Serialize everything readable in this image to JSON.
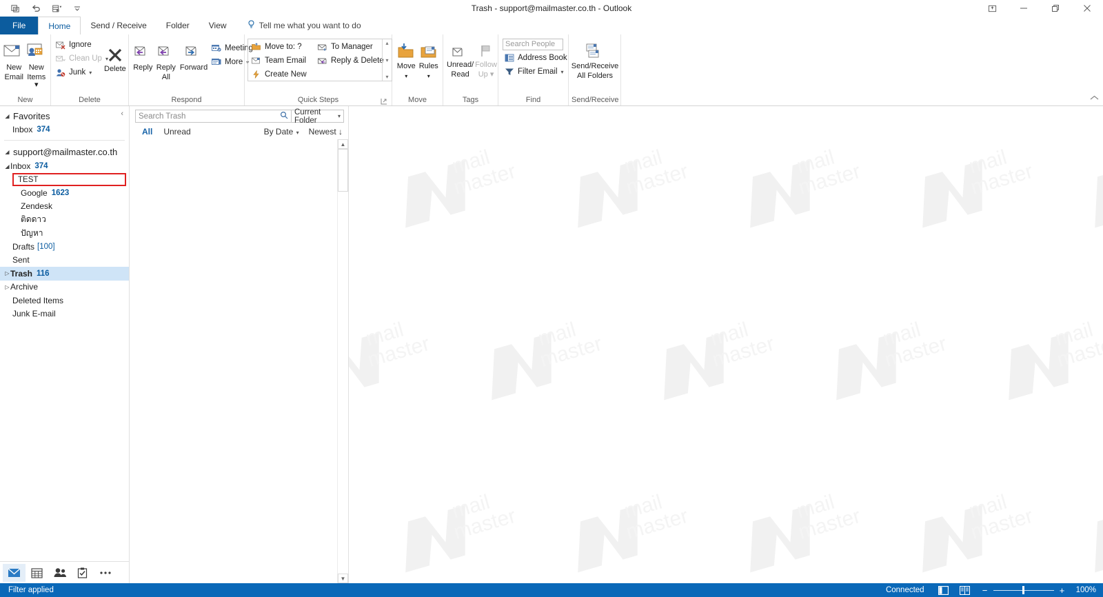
{
  "window": {
    "title": "Trash - support@mailmaster.co.th  -  Outlook",
    "quick_access": [
      {
        "name": "save-attachments-icon",
        "label": "Save"
      },
      {
        "name": "undo-icon",
        "label": "Undo"
      },
      {
        "name": "send-receive-icon",
        "label": "Send/Receive All Folders"
      },
      {
        "name": "customize-qat-icon",
        "label": "Customize Quick Access Toolbar"
      }
    ],
    "controls": {
      "ribbon_display": "Ribbon Display Options",
      "minimize": "Minimize",
      "restore": "Restore Down",
      "close": "Close"
    }
  },
  "tabs": [
    {
      "label": "File",
      "id": "file"
    },
    {
      "label": "Home",
      "id": "home"
    },
    {
      "label": "Send / Receive",
      "id": "send-receive"
    },
    {
      "label": "Folder",
      "id": "folder"
    },
    {
      "label": "View",
      "id": "view"
    }
  ],
  "active_tab": "Home",
  "tell_me": "Tell me what you want to do",
  "ribbon": {
    "groups": [
      {
        "id": "new",
        "label": "New",
        "buttons": [
          {
            "name": "new-email-button",
            "line1": "New",
            "line2": "Email"
          },
          {
            "name": "new-items-button",
            "line1": "New",
            "line2": "Items ▾"
          }
        ]
      },
      {
        "id": "delete",
        "label": "Delete",
        "small": [
          {
            "name": "ignore-button",
            "label": "Ignore",
            "disabled": false
          },
          {
            "name": "clean-up-button",
            "label": "Clean Up",
            "caret": true,
            "disabled": true
          },
          {
            "name": "junk-button",
            "label": "Junk",
            "caret": true,
            "disabled": false
          }
        ],
        "buttons": [
          {
            "name": "delete-button",
            "line1": "Delete",
            "line2": ""
          }
        ]
      },
      {
        "id": "respond",
        "label": "Respond",
        "buttons": [
          {
            "name": "reply-button",
            "line1": "Reply",
            "line2": ""
          },
          {
            "name": "reply-all-button",
            "line1": "Reply",
            "line2": "All"
          },
          {
            "name": "forward-button",
            "line1": "Forward",
            "line2": ""
          }
        ],
        "small": [
          {
            "name": "meeting-button",
            "label": "Meeting"
          },
          {
            "name": "more-respond-button",
            "label": "More",
            "caret": true
          }
        ]
      },
      {
        "id": "quick-steps",
        "label": "Quick Steps",
        "col1": [
          {
            "name": "move-to-quickstep",
            "label": "Move to: ?"
          },
          {
            "name": "team-email-quickstep",
            "label": "Team Email"
          },
          {
            "name": "create-new-quickstep",
            "label": "Create New"
          }
        ],
        "col2": [
          {
            "name": "to-manager-quickstep",
            "label": "To Manager"
          },
          {
            "name": "reply-delete-quickstep",
            "label": "Reply & Delete"
          }
        ]
      },
      {
        "id": "move",
        "label": "Move",
        "buttons": [
          {
            "name": "move-button",
            "line1": "Move",
            "line2": "▾"
          },
          {
            "name": "rules-button",
            "line1": "Rules",
            "line2": "▾"
          }
        ]
      },
      {
        "id": "tags",
        "label": "Tags",
        "buttons": [
          {
            "name": "unread-read-button",
            "line1": "Unread/",
            "line2": "Read"
          },
          {
            "name": "follow-up-button",
            "line1": "Follow",
            "line2": "Up ▾",
            "disabled": true
          }
        ]
      },
      {
        "id": "find",
        "label": "Find",
        "search_people_placeholder": "Search People",
        "small": [
          {
            "name": "address-book-button",
            "label": "Address Book"
          },
          {
            "name": "filter-email-button",
            "label": "Filter Email",
            "caret": true
          }
        ]
      },
      {
        "id": "send-receive-group",
        "label": "Send/Receive",
        "buttons": [
          {
            "name": "send-receive-all-folders-button",
            "line1": "Send/Receive",
            "line2": "All Folders"
          }
        ]
      }
    ]
  },
  "folder_pane": {
    "favorites": {
      "label": "Favorites",
      "items": [
        {
          "name": "favorite-inbox",
          "label": "Inbox",
          "count": "374"
        }
      ]
    },
    "account": "support@mailmaster.co.th",
    "folders": [
      {
        "name": "folder-inbox",
        "label": "Inbox",
        "count": "374",
        "indent": 0,
        "expander": "expanded"
      },
      {
        "name": "folder-test",
        "label": "TEST",
        "count": "",
        "indent": 1,
        "highlighted": true
      },
      {
        "name": "folder-google",
        "label": "Google",
        "count": "1623",
        "indent": 1
      },
      {
        "name": "folder-zendesk",
        "label": "Zendesk",
        "count": "",
        "indent": 1
      },
      {
        "name": "folder-tid-dao",
        "label": "ติดดาว",
        "count": "",
        "indent": 1
      },
      {
        "name": "folder-panha",
        "label": "ปัญหา",
        "count": "",
        "indent": 1
      },
      {
        "name": "folder-drafts",
        "label": "Drafts",
        "count": "[100]",
        "indent": 0,
        "bracket": true
      },
      {
        "name": "folder-sent",
        "label": "Sent",
        "count": "",
        "indent": 0
      },
      {
        "name": "folder-trash",
        "label": "Trash",
        "count": "116",
        "indent": 0,
        "expander": "collapsed",
        "selected": true
      },
      {
        "name": "folder-archive",
        "label": "Archive",
        "count": "",
        "indent": 0,
        "expander": "collapsed"
      },
      {
        "name": "folder-deleted-items",
        "label": "Deleted Items",
        "count": "",
        "indent": 0
      },
      {
        "name": "folder-junk-email",
        "label": "Junk E-mail",
        "count": "",
        "indent": 0
      }
    ],
    "nav_buttons": [
      {
        "name": "nav-mail-icon",
        "label": "Mail",
        "active": true
      },
      {
        "name": "nav-calendar-icon",
        "label": "Calendar",
        "active": false
      },
      {
        "name": "nav-people-icon",
        "label": "People",
        "active": false
      },
      {
        "name": "nav-tasks-icon",
        "label": "Tasks",
        "active": false
      },
      {
        "name": "nav-more-icon",
        "label": "More",
        "active": false
      }
    ]
  },
  "message_list": {
    "search_placeholder": "Search Trash",
    "scope": "Current Folder",
    "filter_all": "All",
    "filter_unread": "Unread",
    "sort_by": "By Date",
    "sort_order": "Newest",
    "items": []
  },
  "status_bar": {
    "left": "Filter applied",
    "connection": "Connected",
    "zoom": "100%",
    "view_normal": "Normal view",
    "view_reading": "Reading view"
  },
  "watermark": {
    "line1": "mail",
    "line2": "master"
  },
  "colors": {
    "accent": "#0a68b8",
    "file_tab": "#0c5c9e",
    "selection": "#cfe4f7",
    "highlight_red": "#e02020",
    "count_blue": "#0b5ca0"
  }
}
